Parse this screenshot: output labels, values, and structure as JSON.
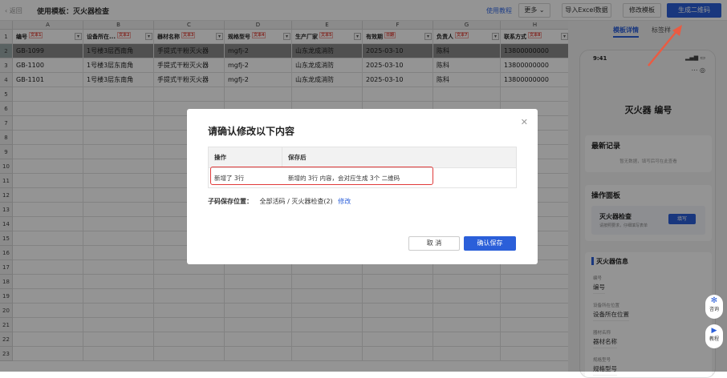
{
  "topbar": {
    "back_label": "返回",
    "title": "使用模板：灭火器检查",
    "tutorial_link": "使用教程",
    "more_button": "更多",
    "import_button": "导入Excel数据",
    "edit_template_button": "修改模板",
    "generate_button": "生成二维码"
  },
  "sheet": {
    "columns": [
      "A",
      "B",
      "C",
      "D",
      "E",
      "F",
      "G",
      "H"
    ],
    "headers": [
      {
        "label": "编号",
        "tag": "文本1"
      },
      {
        "label": "设备所在...",
        "tag": "文本2"
      },
      {
        "label": "器材名称",
        "tag": "文本3"
      },
      {
        "label": "规格型号",
        "tag": "文本4"
      },
      {
        "label": "生产厂家",
        "tag": "文本5"
      },
      {
        "label": "有效期",
        "tag": "日期"
      },
      {
        "label": "负责人",
        "tag": "文本7"
      },
      {
        "label": "联系方式",
        "tag": "文本8"
      }
    ],
    "rows": [
      [
        "GB-1099",
        "1号楼3层西南角",
        "手提式干粉灭火器",
        "mgfj-2",
        "山东龙成消防",
        "2025-03-10",
        "陈科",
        "13800000000"
      ],
      [
        "GB-1100",
        "1号楼3层东南角",
        "手提式干粉灭火器",
        "mgfj-2",
        "山东龙成消防",
        "2025-03-10",
        "陈科",
        "13800000000"
      ],
      [
        "GB-1101",
        "1号楼3层东南角",
        "手提式干粉灭火器",
        "mgfj-2",
        "山东龙成消防",
        "2025-03-10",
        "陈科",
        "13800000000"
      ]
    ],
    "row_numbers": [
      "1",
      "2",
      "3",
      "4",
      "5",
      "6",
      "7",
      "8",
      "9",
      "10",
      "11",
      "12",
      "13",
      "14",
      "15",
      "16",
      "17",
      "18",
      "19",
      "20",
      "21",
      "22",
      "23"
    ]
  },
  "right_panel": {
    "tabs": [
      "模板详情",
      "标签样"
    ],
    "phone": {
      "time": "9:41",
      "title": "灭火器 编号",
      "latest_title": "最新记录",
      "latest_empty": "暂无数据，填写后可在此查看",
      "ops_title": "操作面板",
      "ops_item_title": "灭火器检查",
      "ops_item_sub": "请按照要求，仔细填写表单",
      "ops_item_button": "填写",
      "info_title": "灭火器信息",
      "fields": [
        {
          "label": "编号",
          "value": "编号"
        },
        {
          "label": "设备所在位置",
          "value": "设备所在位置"
        },
        {
          "label": "器材名称",
          "value": "器材名称"
        },
        {
          "label": "规格型号",
          "value": "规格型号"
        }
      ]
    },
    "float_buttons": [
      "咨询",
      "教程"
    ]
  },
  "modal": {
    "title": "请确认修改以下内容",
    "table_headers": [
      "操作",
      "保存后"
    ],
    "row": [
      "新增了 3行",
      "新增的 3行 内容，会对应生成 3个 二维码"
    ],
    "location_label": "子码保存位置：",
    "location_path": "全部活码 / 灭火器检查(2)",
    "location_edit": "修改",
    "cancel_button": "取 消",
    "confirm_button": "确认保存"
  },
  "colors": {
    "primary": "#2b5fd9",
    "highlight": "#e03a3a"
  }
}
